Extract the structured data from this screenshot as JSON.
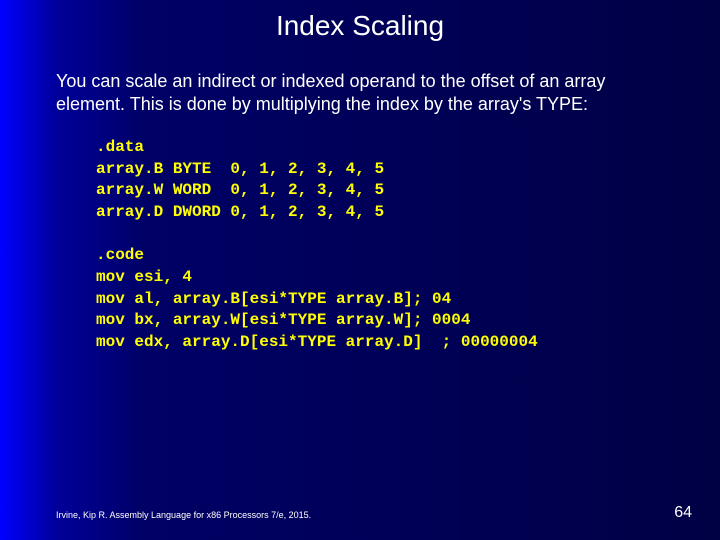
{
  "title": "Index Scaling",
  "paragraph": "You can scale an indirect or indexed operand to the offset of an array element. This is done by multiplying the index by the array's TYPE:",
  "code1": ".data\narray.B BYTE  0, 1, 2, 3, 4, 5\narray.W WORD  0, 1, 2, 3, 4, 5\narray.D DWORD 0, 1, 2, 3, 4, 5",
  "code2": ".code\nmov esi, 4\nmov al, array.B[esi*TYPE array.B]; 04\nmov bx, array.W[esi*TYPE array.W]; 0004\nmov edx, array.D[esi*TYPE array.D]  ; 00000004",
  "citation": "Irvine, Kip R. Assembly Language for x86 Processors 7/e, 2015.",
  "page": "64"
}
